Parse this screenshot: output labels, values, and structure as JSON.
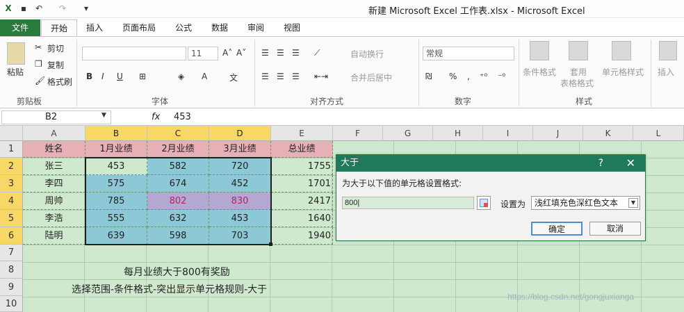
{
  "window": {
    "title": "新建 Microsoft Excel 工作表.xlsx - Microsoft Excel"
  },
  "quick_access": [
    "excel-logo-icon",
    "save-icon",
    "undo-icon",
    "redo-icon",
    "customize-icon"
  ],
  "tabs": [
    {
      "label": "文件"
    },
    {
      "label": "开始"
    },
    {
      "label": "插入"
    },
    {
      "label": "页面布局"
    },
    {
      "label": "公式"
    },
    {
      "label": "数据"
    },
    {
      "label": "审阅"
    },
    {
      "label": "视图"
    }
  ],
  "ribbon": {
    "clipboard": {
      "paste": "粘贴",
      "cut": "剪切",
      "copy": "复制",
      "format_painter": "格式刷",
      "label": "剪贴板"
    },
    "font": {
      "font_size": "11",
      "bold": "B",
      "italic": "I",
      "underline": "U",
      "grow": "A˄",
      "shrink": "A˅",
      "label": "字体"
    },
    "alignment": {
      "wrap": "自动换行",
      "merge": "合并后居中",
      "label": "对齐方式"
    },
    "number": {
      "format": "常规",
      "percent": "%",
      "comma": ",",
      "label": "数字"
    },
    "styles": {
      "conditional": "条件格式",
      "table_format_1": "套用",
      "table_format_2": "表格格式",
      "cell_styles": "单元格样式",
      "label": "样式"
    },
    "cells": {
      "insert": "插入"
    }
  },
  "formula_bar": {
    "name_box": "B2",
    "fx": "fx",
    "value": "453"
  },
  "columns": [
    "A",
    "B",
    "C",
    "D",
    "E",
    "F",
    "G",
    "H",
    "I",
    "J",
    "K",
    "L"
  ],
  "rows": [
    "1",
    "2",
    "3",
    "4",
    "5",
    "6",
    "7",
    "8",
    "9",
    "10"
  ],
  "sheet": {
    "headers": [
      "姓名",
      "1月业绩",
      "2月业绩",
      "3月业绩",
      "总业绩"
    ],
    "data": [
      {
        "name": "张三",
        "m1": "453",
        "m2": "582",
        "m3": "720",
        "total": "1755"
      },
      {
        "name": "李四",
        "m1": "575",
        "m2": "674",
        "m3": "452",
        "total": "1701"
      },
      {
        "name": "周帅",
        "m1": "785",
        "m2": "802",
        "m3": "830",
        "total": "2417"
      },
      {
        "name": "李浩",
        "m1": "555",
        "m2": "632",
        "m3": "453",
        "total": "1640"
      },
      {
        "name": "陆明",
        "m1": "639",
        "m2": "598",
        "m3": "703",
        "total": "1940"
      }
    ],
    "note_row8": "每月业绩大于800有奖励",
    "note_row9": "选择范围-条件格式-突出显示单元格规则-大于"
  },
  "dialog": {
    "title": "大于",
    "help": "?",
    "close": "✕",
    "prompt": "为大于以下值的单元格设置格式:",
    "input_value": "800|",
    "set_label": "设置为",
    "format_option": "浅红填充色深红色文本",
    "ok": "确定",
    "cancel": "取消"
  },
  "watermark": "https://blog.csdn.net/gongjuxianga",
  "colors": {
    "file_tab": "#2b7a3d",
    "dialog_title": "#1e7a5a",
    "header_fill": "#e7b0b6",
    "data_fill": "#8cc8d6",
    "highlight_fill": "#b4a7d2",
    "highlight_text": "#b0285f",
    "sheet_bg": "#cfe9cf",
    "selected_header": "#f7d766"
  }
}
